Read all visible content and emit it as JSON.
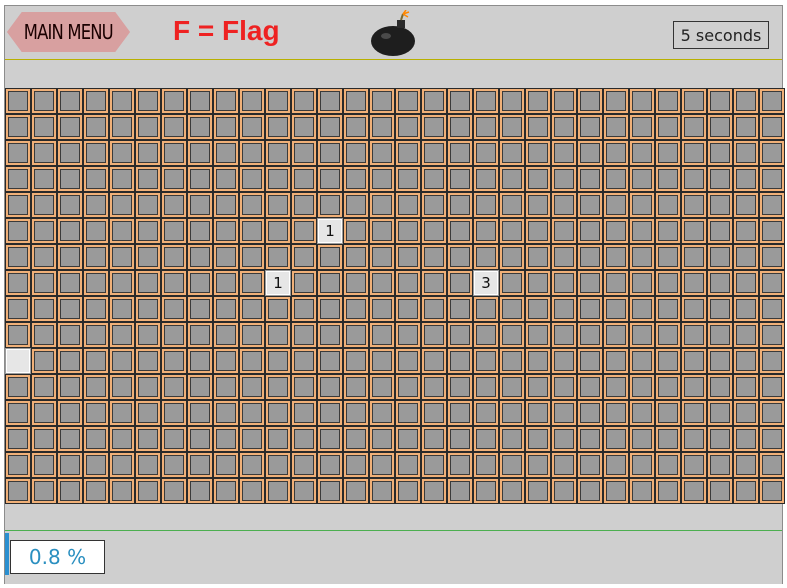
{
  "header": {
    "menu_label": "MAIN MENU",
    "flag_hint": "F = Flag",
    "timer": "5 seconds"
  },
  "icons": {
    "bomb": "bomb-icon"
  },
  "board": {
    "columns": 30,
    "rows": 16,
    "revealed": [
      {
        "row": 5,
        "col": 12,
        "text": "1"
      },
      {
        "row": 7,
        "col": 10,
        "text": "1"
      },
      {
        "row": 7,
        "col": 18,
        "text": "3"
      },
      {
        "row": 10,
        "col": 0,
        "text": ""
      }
    ]
  },
  "footer": {
    "progress": "0.8 %"
  },
  "colors": {
    "flag_hint": "#ee2222",
    "menu_button": "#d8a0a0",
    "tile": "#9a9a9a",
    "tile_border": "#f0b078",
    "progress_text": "#2a8fc0"
  }
}
